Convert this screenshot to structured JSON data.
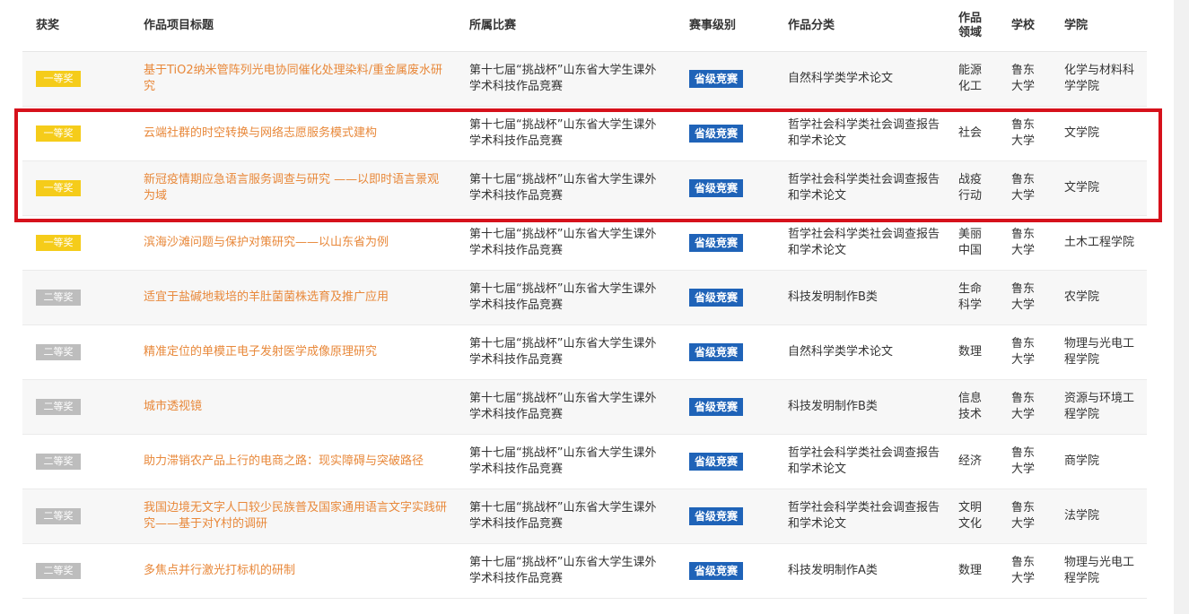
{
  "headers": {
    "award": "获奖",
    "title": "作品项目标题",
    "competition": "所属比赛",
    "level": "赛事级别",
    "category": "作品分类",
    "field": "作品领域",
    "school": "学校",
    "college": "学院"
  },
  "rows": [
    {
      "award": "一等奖",
      "award_type": "first",
      "title": "基于TiO2纳米管阵列光电协同催化处理染料/重金属废水研究",
      "competition": "第十七届“挑战杯”山东省大学生课外学术科技作品竞赛",
      "level": "省级竞赛",
      "category": "自然科学类学术论文",
      "field": "能源化工",
      "school": "鲁东大学",
      "college": "化学与材料科学学院"
    },
    {
      "award": "一等奖",
      "award_type": "first",
      "title": "云端社群的时空转换与网络志愿服务模式建构",
      "competition": "第十七届“挑战杯”山东省大学生课外学术科技作品竞赛",
      "level": "省级竞赛",
      "category": "哲学社会科学类社会调查报告和学术论文",
      "field": "社会",
      "school": "鲁东大学",
      "college": "文学院"
    },
    {
      "award": "一等奖",
      "award_type": "first",
      "title": "新冠疫情期应急语言服务调查与研究 ——以即时语言景观为域",
      "competition": "第十七届“挑战杯”山东省大学生课外学术科技作品竞赛",
      "level": "省级竞赛",
      "category": "哲学社会科学类社会调查报告和学术论文",
      "field": "战疫行动",
      "school": "鲁东大学",
      "college": "文学院"
    },
    {
      "award": "一等奖",
      "award_type": "first",
      "title": "滨海沙滩问题与保护对策研究——以山东省为例",
      "competition": "第十七届“挑战杯”山东省大学生课外学术科技作品竞赛",
      "level": "省级竞赛",
      "category": "哲学社会科学类社会调查报告和学术论文",
      "field": "美丽中国",
      "school": "鲁东大学",
      "college": "土木工程学院"
    },
    {
      "award": "二等奖",
      "award_type": "second",
      "title": "适宜于盐碱地栽培的羊肚菌菌株选育及推广应用",
      "competition": "第十七届“挑战杯”山东省大学生课外学术科技作品竞赛",
      "level": "省级竞赛",
      "category": "科技发明制作B类",
      "field": "生命科学",
      "school": "鲁东大学",
      "college": "农学院"
    },
    {
      "award": "二等奖",
      "award_type": "second",
      "title": "精准定位的单模正电子发射医学成像原理研究",
      "competition": "第十七届“挑战杯”山东省大学生课外学术科技作品竞赛",
      "level": "省级竞赛",
      "category": "自然科学类学术论文",
      "field": "数理",
      "school": "鲁东大学",
      "college": "物理与光电工程学院"
    },
    {
      "award": "二等奖",
      "award_type": "second",
      "title": "城市透视镜",
      "competition": "第十七届“挑战杯”山东省大学生课外学术科技作品竞赛",
      "level": "省级竞赛",
      "category": "科技发明制作B类",
      "field": "信息技术",
      "school": "鲁东大学",
      "college": "资源与环境工程学院"
    },
    {
      "award": "二等奖",
      "award_type": "second",
      "title": "助力滞销农产品上行的电商之路：现实障碍与突破路径",
      "competition": "第十七届“挑战杯”山东省大学生课外学术科技作品竞赛",
      "level": "省级竞赛",
      "category": "哲学社会科学类社会调查报告和学术论文",
      "field": "经济",
      "school": "鲁东大学",
      "college": "商学院"
    },
    {
      "award": "二等奖",
      "award_type": "second",
      "title": "我国边境无文字人口较少民族普及国家通用语言文字实践研究——基于对Y村的调研",
      "competition": "第十七届“挑战杯”山东省大学生课外学术科技作品竞赛",
      "level": "省级竞赛",
      "category": "哲学社会科学类社会调查报告和学术论文",
      "field": "文明文化",
      "school": "鲁东大学",
      "college": "法学院"
    },
    {
      "award": "二等奖",
      "award_type": "second",
      "title": "多焦点并行激光打标机的研制",
      "competition": "第十七届“挑战杯”山东省大学生课外学术科技作品竞赛",
      "level": "省级竞赛",
      "category": "科技发明制作A类",
      "field": "数理",
      "school": "鲁东大学",
      "college": "物理与光电工程学院"
    }
  ],
  "colors": {
    "first_award": "#f5cc1a",
    "second_award": "#bdbdbd",
    "title_link": "#e8883a",
    "level_badge": "#1f63b8",
    "highlight": "#d6111b"
  }
}
